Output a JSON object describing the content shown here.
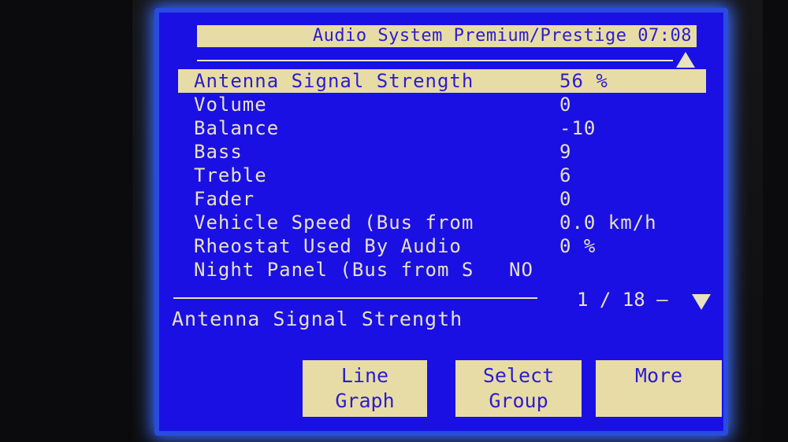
{
  "header": {
    "title": "Audio System Premium/Prestige 07:08"
  },
  "list": {
    "rows": [
      {
        "label": "Antenna Signal Strength",
        "value": "56 %"
      },
      {
        "label": "Volume",
        "value": "0"
      },
      {
        "label": "Balance",
        "value": "-10"
      },
      {
        "label": "Bass",
        "value": "9"
      },
      {
        "label": "Treble",
        "value": "6"
      },
      {
        "label": "Fader",
        "value": "0"
      },
      {
        "label": "Vehicle Speed (Bus from",
        "value": "0.0 km/h"
      },
      {
        "label": "Rheostat Used By Audio",
        "value": "0 %"
      },
      {
        "label": "Night Panel (Bus from S",
        "value": "NO"
      }
    ],
    "selected_index": 0
  },
  "pager": {
    "text": "1 / 18 —"
  },
  "description": {
    "text": "Antenna Signal Strength"
  },
  "softkeys": {
    "line_graph": {
      "line1": "Line",
      "line2": "Graph"
    },
    "select_group": {
      "line1": "Select",
      "line2": "Group"
    },
    "more": {
      "line1": "More"
    }
  },
  "icons": {
    "scroll_up": "up-triangle-icon",
    "scroll_down": "down-triangle-icon"
  },
  "colors": {
    "screen_background": "#1a10e4",
    "highlight": "#e8dca6",
    "highlight_text": "#2b1ccf",
    "text": "#e8e2c0"
  }
}
